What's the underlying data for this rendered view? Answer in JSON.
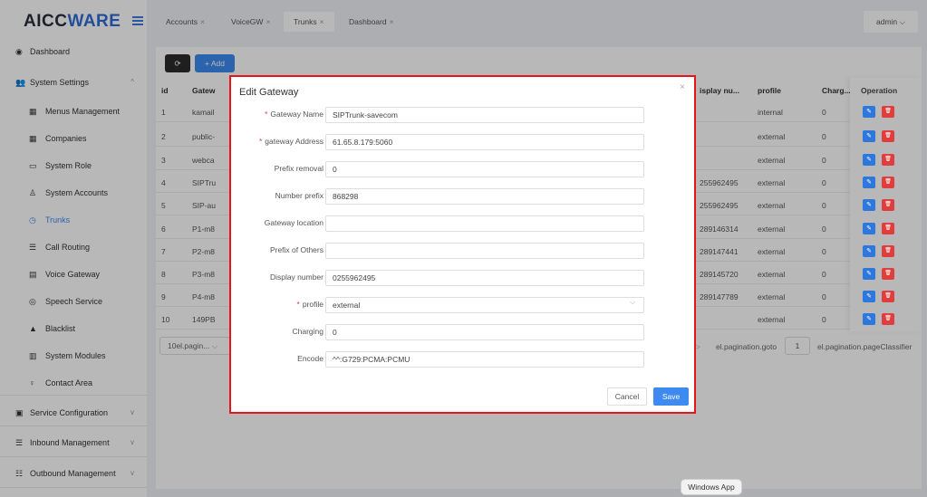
{
  "app": {
    "logo_part1": "AICC",
    "logo_part2": "WARE"
  },
  "sidebar": {
    "items": [
      {
        "label": "Dashboard",
        "icon": "dashboard-icon"
      },
      {
        "label": "System Settings",
        "icon": "users-icon",
        "chevron": "^"
      },
      {
        "label": "Menus Management",
        "icon": "grid-icon"
      },
      {
        "label": "Companies",
        "icon": "grid-icon"
      },
      {
        "label": "System Role",
        "icon": "role-icon"
      },
      {
        "label": "System Accounts",
        "icon": "user-icon"
      },
      {
        "label": "Trunks",
        "icon": "clock-icon",
        "active": true
      },
      {
        "label": "Call Routing",
        "icon": "list-icon"
      },
      {
        "label": "Voice Gateway",
        "icon": "calendar-icon"
      },
      {
        "label": "Speech Service",
        "icon": "speech-icon"
      },
      {
        "label": "Blacklist",
        "icon": "person-icon"
      },
      {
        "label": "System Modules",
        "icon": "modules-icon"
      },
      {
        "label": "Contact Area",
        "icon": "bulb-icon"
      },
      {
        "label": "Service Configuration",
        "icon": "config-icon",
        "chevron": "v"
      },
      {
        "label": "Inbound Management",
        "icon": "inbound-icon",
        "chevron": "v"
      },
      {
        "label": "Outbound Management",
        "icon": "outbound-icon",
        "chevron": "v"
      }
    ]
  },
  "header": {
    "tabs": [
      {
        "label": "Accounts",
        "close": "×"
      },
      {
        "label": "VoiceGW",
        "close": "×"
      },
      {
        "label": "Trunks",
        "close": "×",
        "active": true
      },
      {
        "label": "Dashboard",
        "close": "×"
      }
    ],
    "user": "admin"
  },
  "toolbar": {
    "refresh_icon": "⟳",
    "add_label": "+ Add"
  },
  "table": {
    "headers": {
      "id": "id",
      "gateway": "Gatew",
      "display": "isplay nu...",
      "profile": "profile",
      "charging": "Charg...",
      "operation": "Operation"
    },
    "rows": [
      {
        "id": "1",
        "gateway": "kamail",
        "display": "",
        "profile": "internal",
        "charging": "0"
      },
      {
        "id": "2",
        "gateway": "public-",
        "display": "",
        "profile": "external",
        "charging": "0"
      },
      {
        "id": "3",
        "gateway": "webca",
        "display": "",
        "profile": "external",
        "charging": "0"
      },
      {
        "id": "4",
        "gateway": "SIPTru",
        "display": "255962495",
        "profile": "external",
        "charging": "0"
      },
      {
        "id": "5",
        "gateway": "SIP-au",
        "display": "255962495",
        "profile": "external",
        "charging": "0"
      },
      {
        "id": "6",
        "gateway": "P1-m8",
        "display": "289146314",
        "profile": "external",
        "charging": "0"
      },
      {
        "id": "7",
        "gateway": "P2-m8",
        "display": "289147441",
        "profile": "external",
        "charging": "0"
      },
      {
        "id": "8",
        "gateway": "P3-m8",
        "display": "289145720",
        "profile": "external",
        "charging": "0"
      },
      {
        "id": "9",
        "gateway": "P4-m8",
        "display": "289147789",
        "profile": "external",
        "charging": "0"
      },
      {
        "id": "10",
        "gateway": "149PB",
        "display": "",
        "profile": "external",
        "charging": "0"
      }
    ]
  },
  "pagination": {
    "size_label": "10el.pagin...",
    "goto_label": "el.pagination.goto",
    "page": "1",
    "classifier": "el.pagination.pageClassifier"
  },
  "dialog": {
    "title": "Edit Gateway",
    "close": "×",
    "fields": [
      {
        "label": "Gateway Name",
        "required": true,
        "value": "SIPTrunk-savecom"
      },
      {
        "label": "gateway Address",
        "required": true,
        "value": "61.65.8.179:5060"
      },
      {
        "label": "Prefix removal",
        "required": false,
        "value": "0"
      },
      {
        "label": "Number prefix",
        "required": false,
        "value": "868298"
      },
      {
        "label": "Gateway location",
        "required": false,
        "value": ""
      },
      {
        "label": "Prefix of Others",
        "required": false,
        "value": ""
      },
      {
        "label": "Display number",
        "required": false,
        "value": "0255962495"
      },
      {
        "label": "profile",
        "required": true,
        "value": "external",
        "type": "select"
      },
      {
        "label": "Charging",
        "required": false,
        "value": "0"
      },
      {
        "label": "Encode",
        "required": false,
        "value": "^^:G729:PCMA:PCMU"
      }
    ],
    "cancel_label": "Cancel",
    "save_label": "Save"
  },
  "os_tooltip": "Windows App",
  "colors": {
    "primary": "#3e8af0",
    "danger": "#e03e3e",
    "highlight_border": "#e8141b"
  }
}
